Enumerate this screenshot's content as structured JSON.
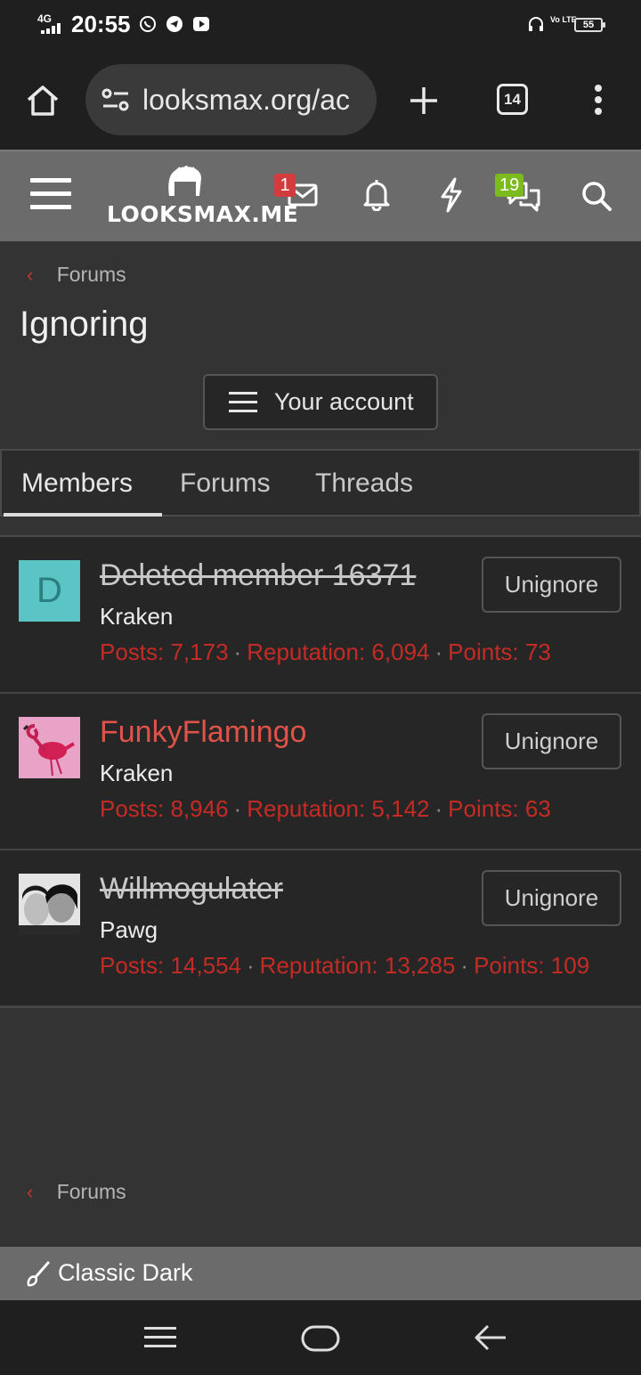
{
  "status_bar": {
    "network": "4G",
    "time": "20:55",
    "volte": "Vo LTE",
    "battery": "55"
  },
  "browser": {
    "url": "looksmax.org/ac",
    "tab_count": "14"
  },
  "site_header": {
    "logo": "LOOKSMAX.ME",
    "inbox_badge": "1",
    "chats_badge": "19"
  },
  "breadcrumb": {
    "label": "Forums"
  },
  "page": {
    "title": "Ignoring"
  },
  "account_button": {
    "label": "Your account"
  },
  "tabs": [
    {
      "label": "Members"
    },
    {
      "label": "Forums"
    },
    {
      "label": "Threads"
    }
  ],
  "members": [
    {
      "name": "Deleted member 16371",
      "avatar_letter": "D",
      "avatar_color": "#5bc4c4",
      "user_title": "Kraken",
      "posts": "Posts: 7,173",
      "reputation": "Reputation: 6,094",
      "points": "Points: 73",
      "button": "Unignore"
    },
    {
      "name": "FunkyFlamingo",
      "user_title": "Kraken",
      "posts": "Posts: 8,946",
      "reputation": "Reputation: 5,142",
      "points": "Points: 63",
      "button": "Unignore"
    },
    {
      "name": "Willmogulater",
      "user_title": "Pawg",
      "posts": "Posts: 14,554",
      "reputation": "Reputation: 13,285",
      "points": "Points: 109",
      "button": "Unignore"
    }
  ],
  "footer": {
    "breadcrumb": "Forums",
    "style_chooser": "Classic Dark"
  },
  "colors": {
    "accent_red": "#c42b25",
    "header_gray": "#6b6b6b",
    "badge_red": "#d23c3c",
    "badge_green": "#7cbb1e"
  }
}
